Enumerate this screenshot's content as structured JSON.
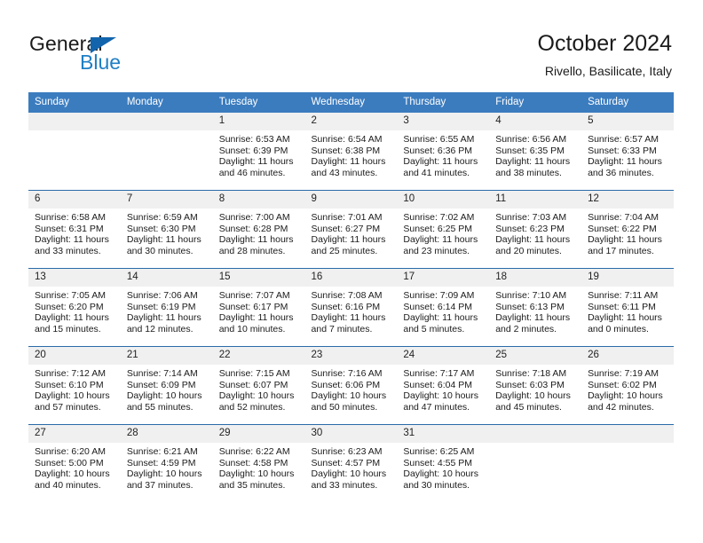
{
  "brand": {
    "name_part1": "General",
    "name_part2": "Blue",
    "accent_color": "#1f7fc4",
    "triangle_color": "#1265ad"
  },
  "header": {
    "title": "October 2024",
    "subtitle": "Rivello, Basilicate, Italy"
  },
  "theme": {
    "header_bg": "#3b7cbf",
    "row_divider": "#2a6ba8",
    "daynum_bg": "#f0f0f0",
    "text": "#1b1b1b"
  },
  "weekday_headers": [
    "Sunday",
    "Monday",
    "Tuesday",
    "Wednesday",
    "Thursday",
    "Friday",
    "Saturday"
  ],
  "weeks": [
    [
      {
        "day": "",
        "sunrise": "",
        "sunset": "",
        "daylight_line1": "",
        "daylight_line2": "",
        "empty": true
      },
      {
        "day": "",
        "sunrise": "",
        "sunset": "",
        "daylight_line1": "",
        "daylight_line2": "",
        "empty": true
      },
      {
        "day": "1",
        "sunrise": "Sunrise: 6:53 AM",
        "sunset": "Sunset: 6:39 PM",
        "daylight_line1": "Daylight: 11 hours",
        "daylight_line2": "and 46 minutes."
      },
      {
        "day": "2",
        "sunrise": "Sunrise: 6:54 AM",
        "sunset": "Sunset: 6:38 PM",
        "daylight_line1": "Daylight: 11 hours",
        "daylight_line2": "and 43 minutes."
      },
      {
        "day": "3",
        "sunrise": "Sunrise: 6:55 AM",
        "sunset": "Sunset: 6:36 PM",
        "daylight_line1": "Daylight: 11 hours",
        "daylight_line2": "and 41 minutes."
      },
      {
        "day": "4",
        "sunrise": "Sunrise: 6:56 AM",
        "sunset": "Sunset: 6:35 PM",
        "daylight_line1": "Daylight: 11 hours",
        "daylight_line2": "and 38 minutes."
      },
      {
        "day": "5",
        "sunrise": "Sunrise: 6:57 AM",
        "sunset": "Sunset: 6:33 PM",
        "daylight_line1": "Daylight: 11 hours",
        "daylight_line2": "and 36 minutes."
      }
    ],
    [
      {
        "day": "6",
        "sunrise": "Sunrise: 6:58 AM",
        "sunset": "Sunset: 6:31 PM",
        "daylight_line1": "Daylight: 11 hours",
        "daylight_line2": "and 33 minutes."
      },
      {
        "day": "7",
        "sunrise": "Sunrise: 6:59 AM",
        "sunset": "Sunset: 6:30 PM",
        "daylight_line1": "Daylight: 11 hours",
        "daylight_line2": "and 30 minutes."
      },
      {
        "day": "8",
        "sunrise": "Sunrise: 7:00 AM",
        "sunset": "Sunset: 6:28 PM",
        "daylight_line1": "Daylight: 11 hours",
        "daylight_line2": "and 28 minutes."
      },
      {
        "day": "9",
        "sunrise": "Sunrise: 7:01 AM",
        "sunset": "Sunset: 6:27 PM",
        "daylight_line1": "Daylight: 11 hours",
        "daylight_line2": "and 25 minutes."
      },
      {
        "day": "10",
        "sunrise": "Sunrise: 7:02 AM",
        "sunset": "Sunset: 6:25 PM",
        "daylight_line1": "Daylight: 11 hours",
        "daylight_line2": "and 23 minutes."
      },
      {
        "day": "11",
        "sunrise": "Sunrise: 7:03 AM",
        "sunset": "Sunset: 6:23 PM",
        "daylight_line1": "Daylight: 11 hours",
        "daylight_line2": "and 20 minutes."
      },
      {
        "day": "12",
        "sunrise": "Sunrise: 7:04 AM",
        "sunset": "Sunset: 6:22 PM",
        "daylight_line1": "Daylight: 11 hours",
        "daylight_line2": "and 17 minutes."
      }
    ],
    [
      {
        "day": "13",
        "sunrise": "Sunrise: 7:05 AM",
        "sunset": "Sunset: 6:20 PM",
        "daylight_line1": "Daylight: 11 hours",
        "daylight_line2": "and 15 minutes."
      },
      {
        "day": "14",
        "sunrise": "Sunrise: 7:06 AM",
        "sunset": "Sunset: 6:19 PM",
        "daylight_line1": "Daylight: 11 hours",
        "daylight_line2": "and 12 minutes."
      },
      {
        "day": "15",
        "sunrise": "Sunrise: 7:07 AM",
        "sunset": "Sunset: 6:17 PM",
        "daylight_line1": "Daylight: 11 hours",
        "daylight_line2": "and 10 minutes."
      },
      {
        "day": "16",
        "sunrise": "Sunrise: 7:08 AM",
        "sunset": "Sunset: 6:16 PM",
        "daylight_line1": "Daylight: 11 hours",
        "daylight_line2": "and 7 minutes."
      },
      {
        "day": "17",
        "sunrise": "Sunrise: 7:09 AM",
        "sunset": "Sunset: 6:14 PM",
        "daylight_line1": "Daylight: 11 hours",
        "daylight_line2": "and 5 minutes."
      },
      {
        "day": "18",
        "sunrise": "Sunrise: 7:10 AM",
        "sunset": "Sunset: 6:13 PM",
        "daylight_line1": "Daylight: 11 hours",
        "daylight_line2": "and 2 minutes."
      },
      {
        "day": "19",
        "sunrise": "Sunrise: 7:11 AM",
        "sunset": "Sunset: 6:11 PM",
        "daylight_line1": "Daylight: 11 hours",
        "daylight_line2": "and 0 minutes."
      }
    ],
    [
      {
        "day": "20",
        "sunrise": "Sunrise: 7:12 AM",
        "sunset": "Sunset: 6:10 PM",
        "daylight_line1": "Daylight: 10 hours",
        "daylight_line2": "and 57 minutes."
      },
      {
        "day": "21",
        "sunrise": "Sunrise: 7:14 AM",
        "sunset": "Sunset: 6:09 PM",
        "daylight_line1": "Daylight: 10 hours",
        "daylight_line2": "and 55 minutes."
      },
      {
        "day": "22",
        "sunrise": "Sunrise: 7:15 AM",
        "sunset": "Sunset: 6:07 PM",
        "daylight_line1": "Daylight: 10 hours",
        "daylight_line2": "and 52 minutes."
      },
      {
        "day": "23",
        "sunrise": "Sunrise: 7:16 AM",
        "sunset": "Sunset: 6:06 PM",
        "daylight_line1": "Daylight: 10 hours",
        "daylight_line2": "and 50 minutes."
      },
      {
        "day": "24",
        "sunrise": "Sunrise: 7:17 AM",
        "sunset": "Sunset: 6:04 PM",
        "daylight_line1": "Daylight: 10 hours",
        "daylight_line2": "and 47 minutes."
      },
      {
        "day": "25",
        "sunrise": "Sunrise: 7:18 AM",
        "sunset": "Sunset: 6:03 PM",
        "daylight_line1": "Daylight: 10 hours",
        "daylight_line2": "and 45 minutes."
      },
      {
        "day": "26",
        "sunrise": "Sunrise: 7:19 AM",
        "sunset": "Sunset: 6:02 PM",
        "daylight_line1": "Daylight: 10 hours",
        "daylight_line2": "and 42 minutes."
      }
    ],
    [
      {
        "day": "27",
        "sunrise": "Sunrise: 6:20 AM",
        "sunset": "Sunset: 5:00 PM",
        "daylight_line1": "Daylight: 10 hours",
        "daylight_line2": "and 40 minutes."
      },
      {
        "day": "28",
        "sunrise": "Sunrise: 6:21 AM",
        "sunset": "Sunset: 4:59 PM",
        "daylight_line1": "Daylight: 10 hours",
        "daylight_line2": "and 37 minutes."
      },
      {
        "day": "29",
        "sunrise": "Sunrise: 6:22 AM",
        "sunset": "Sunset: 4:58 PM",
        "daylight_line1": "Daylight: 10 hours",
        "daylight_line2": "and 35 minutes."
      },
      {
        "day": "30",
        "sunrise": "Sunrise: 6:23 AM",
        "sunset": "Sunset: 4:57 PM",
        "daylight_line1": "Daylight: 10 hours",
        "daylight_line2": "and 33 minutes."
      },
      {
        "day": "31",
        "sunrise": "Sunrise: 6:25 AM",
        "sunset": "Sunset: 4:55 PM",
        "daylight_line1": "Daylight: 10 hours",
        "daylight_line2": "and 30 minutes."
      },
      {
        "day": "",
        "sunrise": "",
        "sunset": "",
        "daylight_line1": "",
        "daylight_line2": "",
        "empty": true
      },
      {
        "day": "",
        "sunrise": "",
        "sunset": "",
        "daylight_line1": "",
        "daylight_line2": "",
        "empty": true
      }
    ]
  ]
}
